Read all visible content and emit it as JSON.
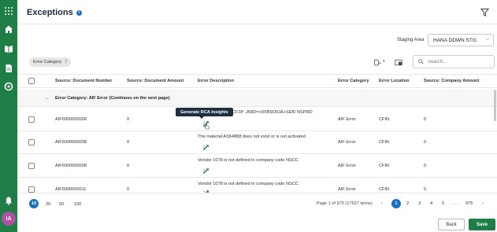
{
  "page": {
    "title": "Exceptions"
  },
  "staging": {
    "label": "Staging Area",
    "value": "HANA DDWN STG"
  },
  "filter_chip": {
    "label": "Error Category",
    "count": "7"
  },
  "search": {
    "placeholder": "Search..."
  },
  "table": {
    "columns": [
      "Source: Document Number",
      "Source: Document Amount",
      "Error Description",
      "Error Category",
      "Error Location",
      "Source: Company Amount"
    ],
    "group_label": "Error Category: AIF Error (Continues on the next page)",
    "rows": [
      {
        "doc_number": "AIF6000000008",
        "doc_amount": "0",
        "description": "CF3P .J58D=+9XB9O9JA+SEB/ NSPRD",
        "category": "AIF Error",
        "location": "CFIN",
        "company_amount": "0"
      },
      {
        "doc_number": "AIF6000000008",
        "doc_amount": "0",
        "description": "The material AS54888 does not exist or is not activated",
        "category": "AIF Error",
        "location": "CFIN",
        "company_amount": "0"
      },
      {
        "doc_number": "AIF6000000008",
        "doc_amount": "0",
        "description": "Vendor 1078 is not defined in company code NSCC",
        "category": "AIF Error",
        "location": "CFIN",
        "company_amount": "0"
      },
      {
        "doc_number": "AIF6000000011",
        "doc_amount": "0",
        "description": "Vendor 1078 is not defined in company code NSCC",
        "category": "AIF Error",
        "location": "CFIN",
        "company_amount": "0"
      }
    ]
  },
  "tooltip": {
    "text": "Generate RCA Insights"
  },
  "pagination": {
    "page_sizes": [
      "10",
      "20",
      "50",
      "100"
    ],
    "info": "Page 1 of 975 (17527 items)",
    "pages": [
      "1",
      "2",
      "3",
      "4",
      "5",
      ". . .",
      "975"
    ]
  },
  "buttons": {
    "back": "Back",
    "save": "Save"
  },
  "user": {
    "initials": "IA"
  },
  "colors": {
    "rail": "#1e7e45",
    "accent": "#1f6fbf",
    "save": "#1e7e45"
  }
}
